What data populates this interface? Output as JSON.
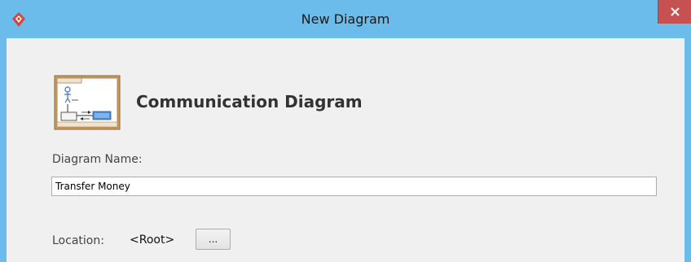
{
  "window": {
    "title": "New Diagram",
    "app_icon": "visual-paradigm-logo-icon",
    "close_icon": "close-icon",
    "titlebar_color": "#6bbcea",
    "close_color": "#c75050"
  },
  "header": {
    "icon": "communication-diagram-icon",
    "title": "Communication Diagram"
  },
  "form": {
    "diagram_name_label": "Diagram Name:",
    "diagram_name_value": "Transfer Money",
    "location_label": "Location:",
    "location_value": "<Root>",
    "browse_label": "..."
  }
}
